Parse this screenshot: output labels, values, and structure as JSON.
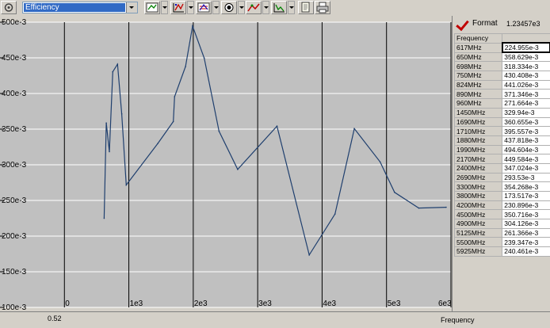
{
  "toolbar": {
    "selector_value": "Efficiency",
    "icons": [
      "settings-icon",
      "chart-type-icon",
      "axis-scale-icon",
      "chart-properties-icon",
      "marker-icon",
      "trace-icon",
      "cursor-icon",
      "copy-icon",
      "print-icon"
    ]
  },
  "panel": {
    "format_label": "Format",
    "format_value": "1.23457e3",
    "column_header": "Frequency",
    "rows": [
      {
        "freq": "617MHz",
        "value": "224.955e-3"
      },
      {
        "freq": "650MHz",
        "value": "358.629e-3"
      },
      {
        "freq": "698MHz",
        "value": "318.334e-3"
      },
      {
        "freq": "750MHz",
        "value": "430.408e-3"
      },
      {
        "freq": "824MHz",
        "value": "441.026e-3"
      },
      {
        "freq": "890MHz",
        "value": "371.346e-3"
      },
      {
        "freq": "960MHz",
        "value": "271.664e-3"
      },
      {
        "freq": "1450MHz",
        "value": "329.94e-3"
      },
      {
        "freq": "1690MHz",
        "value": "360.655e-3"
      },
      {
        "freq": "1710MHz",
        "value": "395.557e-3"
      },
      {
        "freq": "1880MHz",
        "value": "437.818e-3"
      },
      {
        "freq": "1990MHz",
        "value": "494.604e-3"
      },
      {
        "freq": "2170MHz",
        "value": "449.584e-3"
      },
      {
        "freq": "2400MHz",
        "value": "347.024e-3"
      },
      {
        "freq": "2690MHz",
        "value": "293.53e-3"
      },
      {
        "freq": "3300MHz",
        "value": "354.268e-3"
      },
      {
        "freq": "3800MHz",
        "value": "173.517e-3"
      },
      {
        "freq": "4200MHz",
        "value": "230.896e-3"
      },
      {
        "freq": "4500MHz",
        "value": "350.716e-3"
      },
      {
        "freq": "4900MHz",
        "value": "304.126e-3"
      },
      {
        "freq": "5125MHz",
        "value": "261.366e-3"
      },
      {
        "freq": "5500MHz",
        "value": "239.347e-3"
      },
      {
        "freq": "5925MHz",
        "value": "240.461e-3"
      }
    ]
  },
  "status": {
    "left_value": "0.52",
    "x_axis_name": "Frequency"
  },
  "chart_data": {
    "type": "line",
    "title": "",
    "xlabel": "Frequency",
    "ylabel": "",
    "xlim": [
      -1000,
      6000
    ],
    "ylim": [
      0.1,
      0.5
    ],
    "grid": true,
    "x_tick_values": [
      0,
      1000,
      2000,
      3000,
      4000,
      5000,
      6000
    ],
    "x_tick_labels": [
      "0",
      "1e3",
      "2e3",
      "3e3",
      "4e3",
      "5e3",
      "6e3"
    ],
    "y_tick_values": [
      0.1,
      0.15,
      0.2,
      0.25,
      0.3,
      0.35,
      0.4,
      0.45,
      0.5
    ],
    "y_tick_labels": [
      "100e-3",
      "150e-3",
      "200e-3",
      "250e-3",
      "300e-3",
      "350e-3",
      "400e-3",
      "450e-3",
      "500e-3"
    ],
    "line_color": "#1f3f6e",
    "plot_background": "#c0c0c0",
    "series": [
      {
        "x": [
          617,
          650,
          698,
          750,
          824,
          890,
          960,
          1450,
          1690,
          1710,
          1880,
          1990,
          2170,
          2400,
          2690,
          3300,
          3800,
          4200,
          4500,
          4900,
          5125,
          5500,
          5925
        ],
        "values": [
          0.224955,
          0.358629,
          0.318334,
          0.430408,
          0.441026,
          0.371346,
          0.271664,
          0.32994,
          0.360655,
          0.395557,
          0.437818,
          0.494604,
          0.449584,
          0.347024,
          0.29353,
          0.354268,
          0.173517,
          0.230896,
          0.350716,
          0.304126,
          0.261366,
          0.239347,
          0.240461
        ]
      }
    ]
  }
}
